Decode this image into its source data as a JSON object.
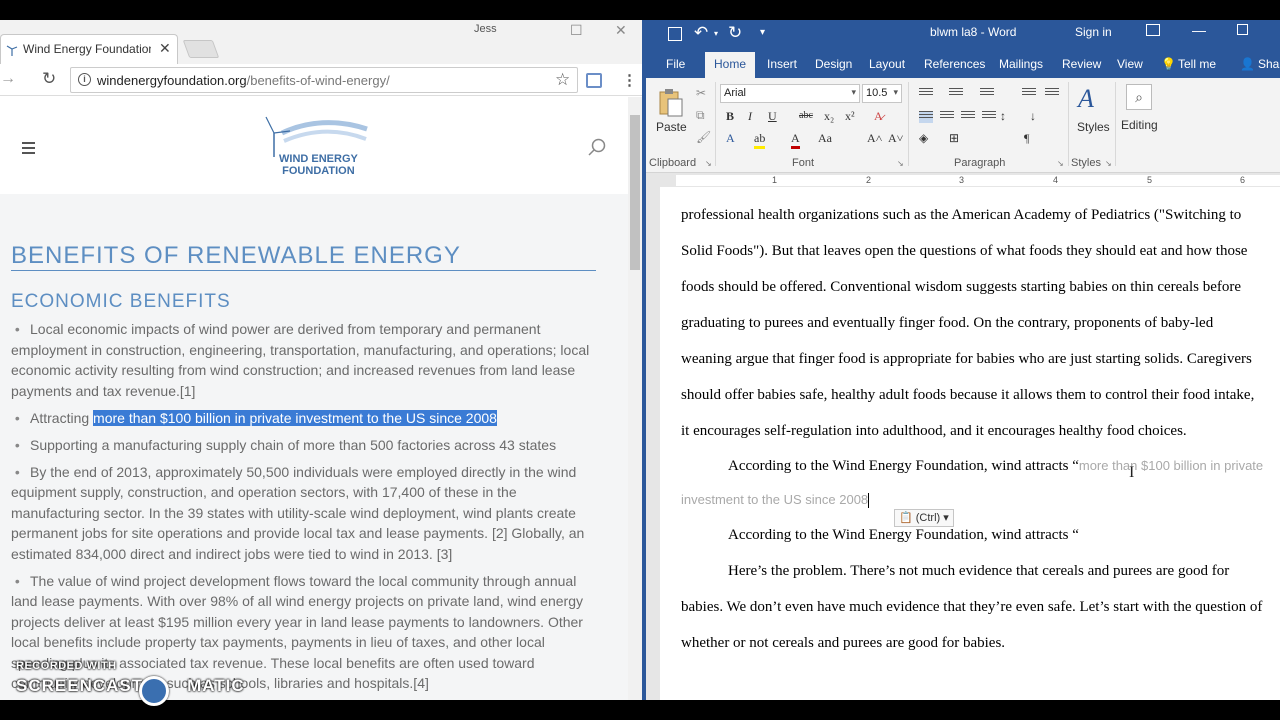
{
  "chrome": {
    "tab_title": "Wind Energy Foundation",
    "window_user": "Jess",
    "url_host": "windenergyfoundation.org",
    "url_path": "/benefits-of-wind-energy/"
  },
  "site": {
    "logo_line1": "WIND ENERGY",
    "logo_line2": "FOUNDATION",
    "h1": "BENEFITS OF RENEWABLE ENERGY",
    "h2": "ECONOMIC BENEFITS",
    "bullets": {
      "b1": "Local economic impacts of wind power are derived from temporary and permanent employment in construction, engineering, transportation, manufacturing, and operations; local economic activity resulting from wind construction; and increased revenues from land lease payments and tax revenue.[1]",
      "b2_prefix": "Attracting ",
      "b2_highlight": "more than $100 billion in private investment to the US since 2008",
      "b3": "Supporting a manufacturing supply chain of more than 500 factories across 43 states",
      "b4": "By the end of 2013, approximately 50,500 individuals were employed directly in the wind equipment supply, construction, and operation sectors, with 17,400 of these in the manufacturing sector. In the 39 states with utility-scale wind deployment, wind plants create permanent jobs for site operations and provide local tax and lease payments. [2] Globally, an estimated 834,000 direct and indirect jobs were tied to wind in 2013. [3]",
      "b5": "The value of wind project development flows toward the local community through annual land lease payments. With over 98% of all wind energy projects on private land, wind energy projects deliver at least $195 million every year in land lease payments to landowners. Other local benefits include property tax payments, payments in lieu of taxes, and other local spending plus its associated tax revenue. These local benefits are often used toward community development such as schools, libraries and hospitals.[4]"
    }
  },
  "word": {
    "title": "blwm la8  -  Word",
    "sign_in": "Sign in",
    "tabs": {
      "file": "File",
      "home": "Home",
      "insert": "Insert",
      "design": "Design",
      "layout": "Layout",
      "references": "References",
      "mailings": "Mailings",
      "review": "Review",
      "view": "View",
      "tell_me": "Tell me",
      "share": "Share"
    },
    "ribbon": {
      "paste": "Paste",
      "font_name": "Arial",
      "font_size": "10.5",
      "styles": "Styles",
      "editing": "Editing",
      "clipboard": "Clipboard",
      "font": "Font",
      "paragraph": "Paragraph",
      "styles_group": "Styles"
    },
    "doc": {
      "l1": "professional health organizations such as the American Academy of Pediatrics (\"Switching to",
      "l2": "Solid Foods\"). But that leaves open the questions of what foods they should eat and how those",
      "l3": "foods should be offered. Conventional wisdom suggests starting babies on thin cereals before",
      "l4": "graduating to purees and eventually finger food. On the contrary, proponents of baby-led",
      "l5": "weaning argue that finger food is appropriate for babies who are just starting solids. Caregivers",
      "l6": "should offer babies safe, healthy adult foods because it allows them to control their food intake,",
      "l7": "it encourages self-regulation into adulthood, and it encourages healthy food choices.",
      "l8_prefix": "According to the Wind Energy Foundation, wind attracts “",
      "l8_pasted": "more than $100 billion in private",
      "l9_pasted": "investment to the US since 2008",
      "l10": "According to the Wind Energy Foundation, wind attracts “",
      "l11": "Here’s the problem. There’s not much evidence that cereals and purees are good for",
      "l12": "babies. We don’t even have much evidence that they’re even safe. Let’s start with the question of",
      "l13": "whether or not cereals and purees are good for babies.",
      "paste_options": "(Ctrl)"
    }
  },
  "watermark": {
    "line1": "RECORDED WITH",
    "line2": "SCREENCAST",
    "line3": "MATIC"
  }
}
